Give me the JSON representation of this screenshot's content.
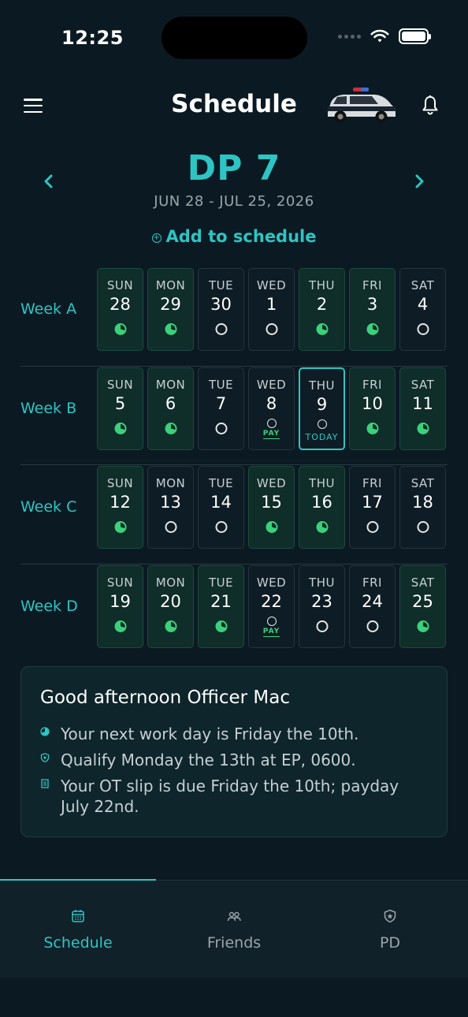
{
  "status": {
    "time": "12:25"
  },
  "header": {
    "title": "Schedule"
  },
  "period": {
    "title": "DP 7",
    "dates": "JUN 28 - JUL 25, 2026"
  },
  "add_link": "Add to schedule",
  "weeks": [
    {
      "label": "Week A",
      "days": [
        {
          "name": "SUN",
          "num": "28",
          "work": true
        },
        {
          "name": "MON",
          "num": "29",
          "work": true
        },
        {
          "name": "TUE",
          "num": "30",
          "work": false
        },
        {
          "name": "WED",
          "num": "1",
          "work": false
        },
        {
          "name": "THU",
          "num": "2",
          "work": true
        },
        {
          "name": "FRI",
          "num": "3",
          "work": true
        },
        {
          "name": "SAT",
          "num": "4",
          "work": false
        }
      ]
    },
    {
      "label": "Week B",
      "days": [
        {
          "name": "SUN",
          "num": "5",
          "work": true
        },
        {
          "name": "MON",
          "num": "6",
          "work": true
        },
        {
          "name": "TUE",
          "num": "7",
          "work": false
        },
        {
          "name": "WED",
          "num": "8",
          "work": false,
          "tag": "PAY"
        },
        {
          "name": "THU",
          "num": "9",
          "work": false,
          "tag": "TODAY"
        },
        {
          "name": "FRI",
          "num": "10",
          "work": true
        },
        {
          "name": "SAT",
          "num": "11",
          "work": true
        }
      ]
    },
    {
      "label": "Week C",
      "days": [
        {
          "name": "SUN",
          "num": "12",
          "work": true
        },
        {
          "name": "MON",
          "num": "13",
          "work": false
        },
        {
          "name": "TUE",
          "num": "14",
          "work": false
        },
        {
          "name": "WED",
          "num": "15",
          "work": true
        },
        {
          "name": "THU",
          "num": "16",
          "work": true
        },
        {
          "name": "FRI",
          "num": "17",
          "work": false
        },
        {
          "name": "SAT",
          "num": "18",
          "work": false
        }
      ]
    },
    {
      "label": "Week D",
      "days": [
        {
          "name": "SUN",
          "num": "19",
          "work": true
        },
        {
          "name": "MON",
          "num": "20",
          "work": true
        },
        {
          "name": "TUE",
          "num": "21",
          "work": true
        },
        {
          "name": "WED",
          "num": "22",
          "work": false,
          "tag": "PAY"
        },
        {
          "name": "THU",
          "num": "23",
          "work": false
        },
        {
          "name": "FRI",
          "num": "24",
          "work": false
        },
        {
          "name": "SAT",
          "num": "25",
          "work": true
        }
      ]
    }
  ],
  "card": {
    "title": "Good afternoon Officer Mac",
    "items": [
      {
        "icon": "work-day-icon",
        "text": "Your next work day is Friday the 10th."
      },
      {
        "icon": "badge-icon",
        "text": "Qualify Monday the 13th at EP, 0600."
      },
      {
        "icon": "document-icon",
        "text": "Your OT slip is due Friday the 10th; payday July 22nd."
      }
    ]
  },
  "tabs": [
    {
      "label": "Schedule",
      "icon": "calendar-icon",
      "active": true
    },
    {
      "label": "Friends",
      "icon": "friends-icon",
      "active": false
    },
    {
      "label": "PD",
      "icon": "shield-icon",
      "active": false
    }
  ],
  "colors": {
    "accent": "#2ec4c4",
    "work": "#3bd17a",
    "background": "#0b1a22"
  }
}
